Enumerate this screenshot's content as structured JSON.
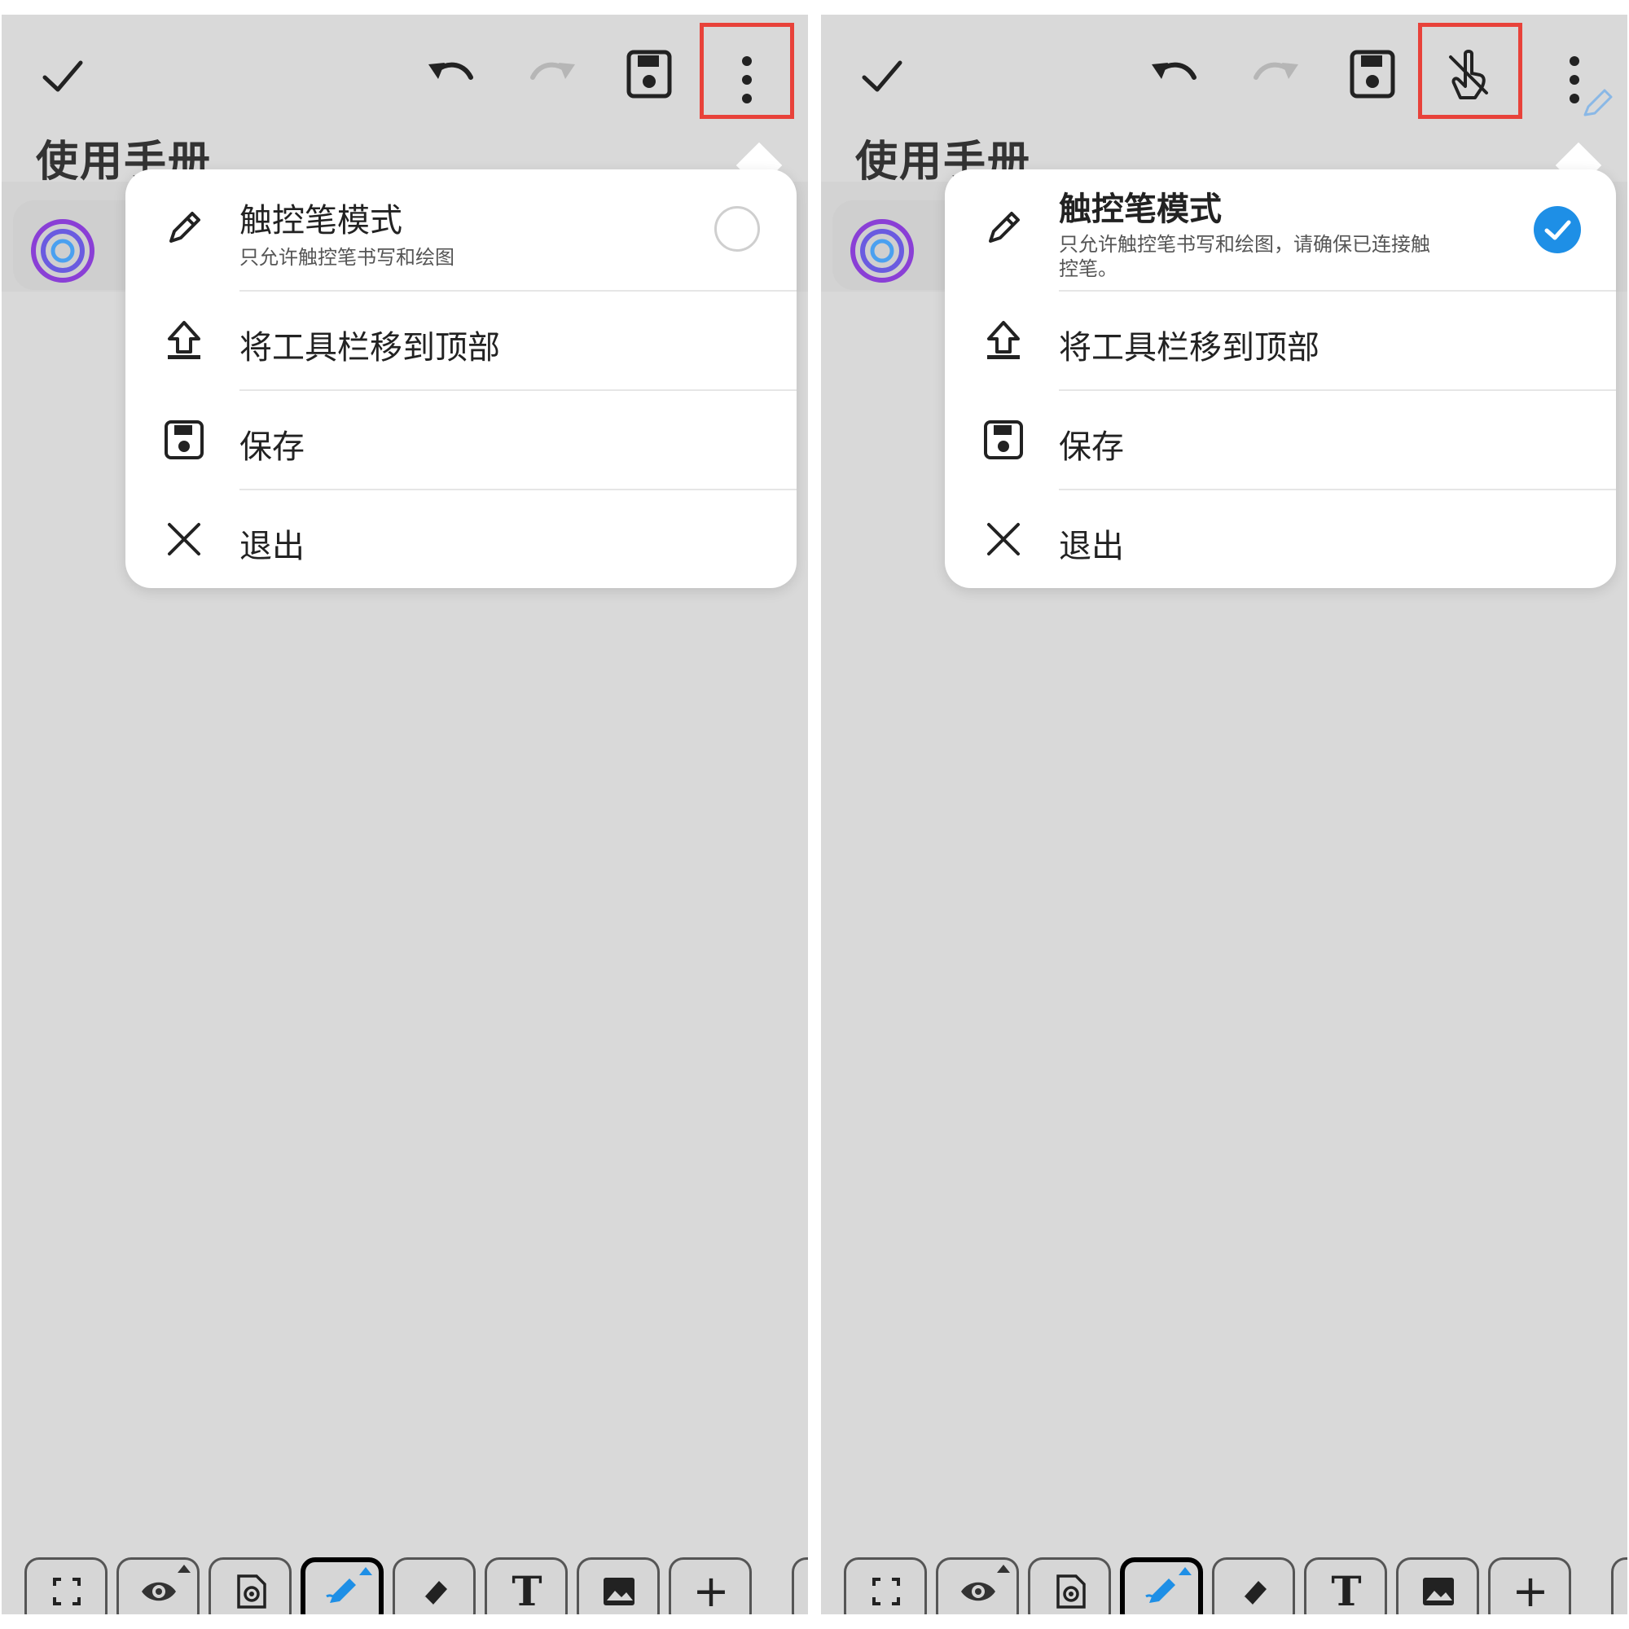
{
  "doc_title": "使用手册",
  "colors": {
    "accent": "#1e8fe6",
    "highlight": "#e8423a",
    "backdrop": "#d9d9d9"
  },
  "toolbar": {
    "confirm": "check-icon",
    "undo": "undo-icon",
    "redo": "redo-icon",
    "save": "save-icon",
    "more": "more-vertical-icon",
    "stylus_toggle": "stylus-touch-icon"
  },
  "menu": {
    "stylus_mode": {
      "label": "触控笔模式",
      "subtitle_off": "只允许触控笔书写和绘图",
      "subtitle_on_line1": "只允许触控笔书写和绘图，请确保已连接触",
      "subtitle_on_line2": "控笔。"
    },
    "move_toolbar_label": "将工具栏移到顶部",
    "save_label": "保存",
    "exit_label": "退出"
  },
  "left_panel": {
    "stylus_mode_enabled": false
  },
  "right_panel": {
    "stylus_mode_enabled": true
  },
  "bottom_tools": [
    "fullscreen-icon",
    "eye-icon",
    "page-settings-icon",
    "pen-icon",
    "eraser-icon",
    "text-icon",
    "image-icon",
    "add-icon"
  ],
  "text_tool_glyph": "T",
  "add_tool_glyph": "+"
}
